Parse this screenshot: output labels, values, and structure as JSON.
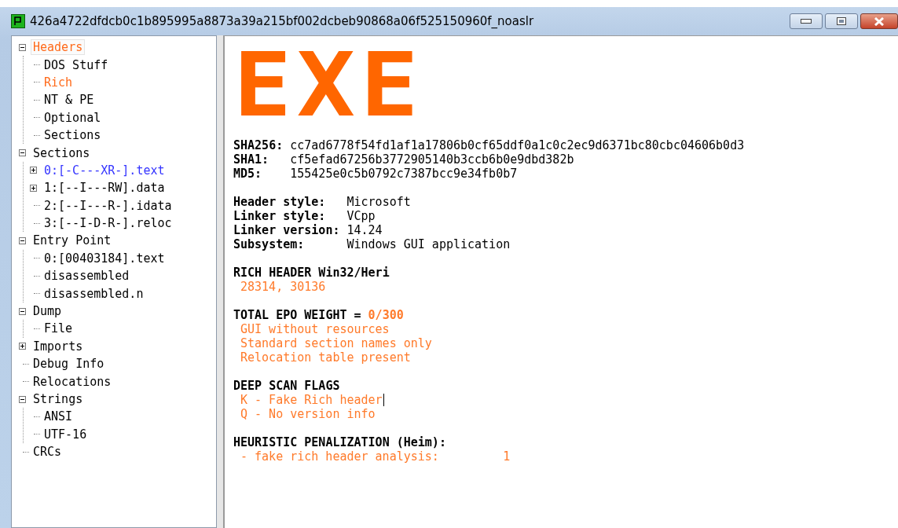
{
  "window": {
    "title": "426a4722dfdcb0c1b895995a8873a39a215bf002dcbeb90868a06f525150960f_noaslr"
  },
  "tree": [
    {
      "label": "Headers",
      "expanded": true,
      "selected": true,
      "color": "#ff6a1a",
      "children": [
        {
          "label": "DOS Stuff",
          "selected": false
        },
        {
          "label": "Rich",
          "selected": false,
          "color": "#ff6a1a"
        },
        {
          "label": "NT & PE",
          "selected": false
        },
        {
          "label": "Optional",
          "selected": false
        },
        {
          "label": "Sections",
          "selected": false
        }
      ]
    },
    {
      "label": "Sections",
      "expanded": true,
      "selected": false,
      "children": [
        {
          "label": "0:[-C---XR-].text",
          "expanded": false,
          "selected": false,
          "color": "#3434ff"
        },
        {
          "label": "1:[--I---RW].data",
          "expanded": false,
          "selected": false
        },
        {
          "label": "2:[--I---R-].idata",
          "selected": false
        },
        {
          "label": "3:[--I-D-R-].reloc",
          "selected": false
        }
      ]
    },
    {
      "label": "Entry Point",
      "expanded": true,
      "selected": false,
      "children": [
        {
          "label": "0:[00403184].text",
          "selected": false
        },
        {
          "label": "disassembled",
          "selected": false
        },
        {
          "label": "disassembled.n",
          "selected": false
        }
      ]
    },
    {
      "label": "Dump",
      "expanded": true,
      "selected": false,
      "children": [
        {
          "label": "File",
          "selected": false
        }
      ]
    },
    {
      "label": "Imports",
      "expanded": false,
      "selected": false
    },
    {
      "label": "Debug Info",
      "selected": false
    },
    {
      "label": "Relocations",
      "selected": false
    },
    {
      "label": "Strings",
      "expanded": true,
      "selected": false,
      "children": [
        {
          "label": "ANSI",
          "selected": false
        },
        {
          "label": "UTF-16",
          "selected": false
        }
      ]
    },
    {
      "label": "CRCs",
      "selected": false
    }
  ],
  "logo": "EXE",
  "hashes": [
    {
      "label": "SHA256:",
      "value": "cc7ad6778f54fd1af1a17806b0cf65ddf0a1c0c2ec9d6371bc80cbc04606b0d3"
    },
    {
      "label": "SHA1:",
      "value": "cf5efad67256b3772905140b3ccb6b0e9dbd382b"
    },
    {
      "label": "MD5:",
      "value": "155425e0c5b0792c7387bcc9e34fb0b7"
    }
  ],
  "info": [
    {
      "label": "Header style:",
      "value": "Microsoft"
    },
    {
      "label": "Linker style:",
      "value": "VCpp"
    },
    {
      "label": "Linker version:",
      "value": "14.24"
    },
    {
      "label": "Subsystem:",
      "value": "Windows GUI application"
    }
  ],
  "sections": [
    {
      "heading": "RICH HEADER Win32/Heri",
      "lines": [
        {
          "text": "28314, 30136"
        }
      ]
    },
    {
      "heading": "TOTAL EPO WEIGHT =",
      "heading_value": "0/300",
      "lines": [
        {
          "text": "GUI without resources"
        },
        {
          "text": "Standard section names only"
        },
        {
          "text": "Relocation table present"
        }
      ]
    },
    {
      "heading": "DEEP SCAN FLAGS",
      "lines": [
        {
          "text": "K - Fake Rich header",
          "cursor": true
        },
        {
          "text": "Q - No version info"
        }
      ]
    },
    {
      "heading": "HEURISTIC PENALIZATION (Heim):",
      "lines": [
        {
          "text": "- fake rich header analysis:",
          "value": "1"
        }
      ]
    }
  ]
}
